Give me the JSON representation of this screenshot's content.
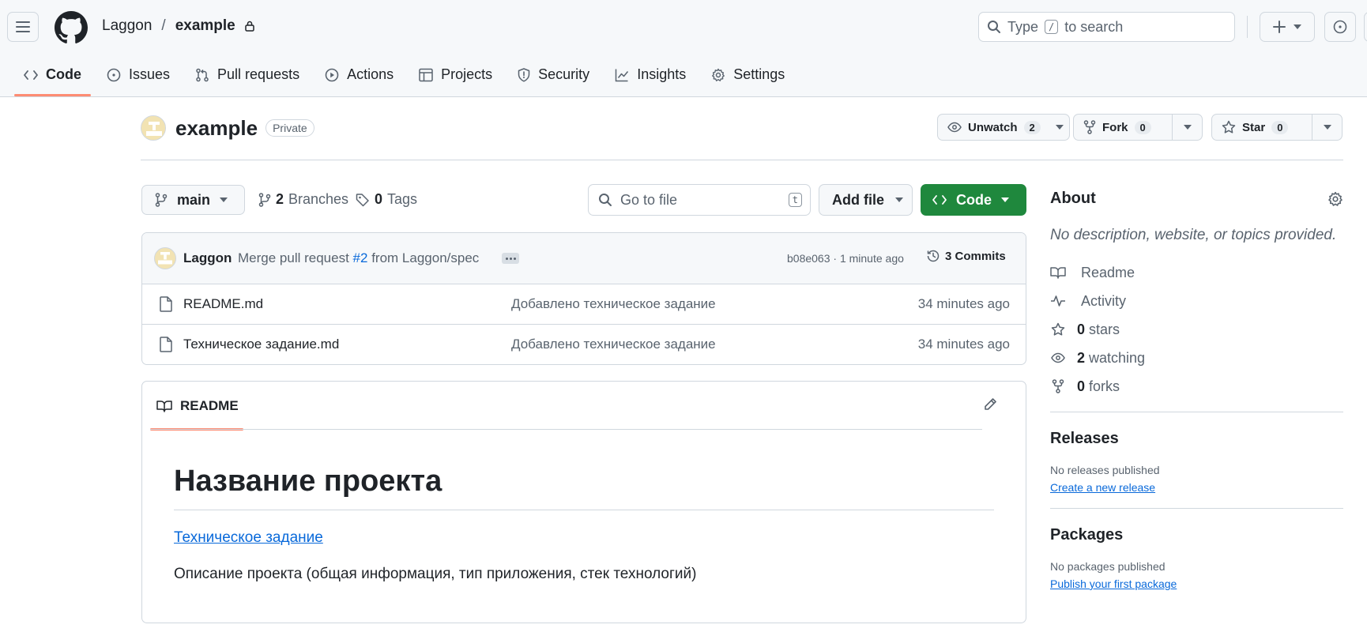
{
  "header": {
    "owner": "Laggon",
    "separator": "/",
    "repo": "example",
    "search": {
      "prefix": "Type",
      "key": "/",
      "suffix": "to search"
    },
    "plus_label": "+"
  },
  "tabs": [
    {
      "label": "Code",
      "icon": "code-icon",
      "active": true
    },
    {
      "label": "Issues",
      "icon": "issue-opened-icon"
    },
    {
      "label": "Pull requests",
      "icon": "git-pull-request-icon"
    },
    {
      "label": "Actions",
      "icon": "play-icon"
    },
    {
      "label": "Projects",
      "icon": "table-icon"
    },
    {
      "label": "Security",
      "icon": "shield-icon"
    },
    {
      "label": "Insights",
      "icon": "graph-icon"
    },
    {
      "label": "Settings",
      "icon": "gear-icon"
    }
  ],
  "repo_head": {
    "name": "example",
    "visibility": "Private",
    "unwatch": {
      "label": "Unwatch",
      "count": "2"
    },
    "fork": {
      "label": "Fork",
      "count": "0"
    },
    "star": {
      "label": "Star",
      "count": "0"
    }
  },
  "toolbar": {
    "branch": "main",
    "branches_count": "2",
    "branches_label": "Branches",
    "tags_count": "0",
    "tags_label": "Tags",
    "goto_placeholder": "Go to file",
    "goto_key": "t",
    "add_file": "Add file",
    "code": "Code"
  },
  "latest_commit": {
    "author": "Laggon",
    "message_prefix": "Merge pull request",
    "pr_link": "#2",
    "message_suffix": "from Laggon/spec",
    "sha_time": "b08e063 · 1 minute ago",
    "commits": "3 Commits"
  },
  "files": [
    {
      "name": "README.md",
      "message": "Добавлено техническое задание",
      "time": "34 minutes ago"
    },
    {
      "name": "Техническое задание.md",
      "message": "Добавлено техническое задание",
      "time": "34 minutes ago"
    }
  ],
  "readme": {
    "tab": "README",
    "heading": "Название проекта",
    "link": "Техническое задание",
    "paragraph": "Описание проекта (общая информация, тип приложения, стек технологий)"
  },
  "sidebar": {
    "about_title": "About",
    "description": "No description, website, or topics provided.",
    "items": [
      {
        "icon": "book-icon",
        "count": "",
        "label": "Readme"
      },
      {
        "icon": "pulse-icon",
        "count": "",
        "label": "Activity"
      },
      {
        "icon": "star-icon",
        "count": "0",
        "label": "stars"
      },
      {
        "icon": "eye-icon",
        "count": "2",
        "label": "watching"
      },
      {
        "icon": "repo-forked-icon",
        "count": "0",
        "label": "forks"
      }
    ],
    "releases_title": "Releases",
    "releases_text": "No releases published",
    "releases_link": "Create a new release",
    "packages_title": "Packages",
    "packages_text": "No packages published",
    "packages_link": "Publish your first package"
  },
  "colors": {
    "accent_green": "#1f883d",
    "link": "#0969da",
    "tab_underline": "#fd8c73"
  }
}
